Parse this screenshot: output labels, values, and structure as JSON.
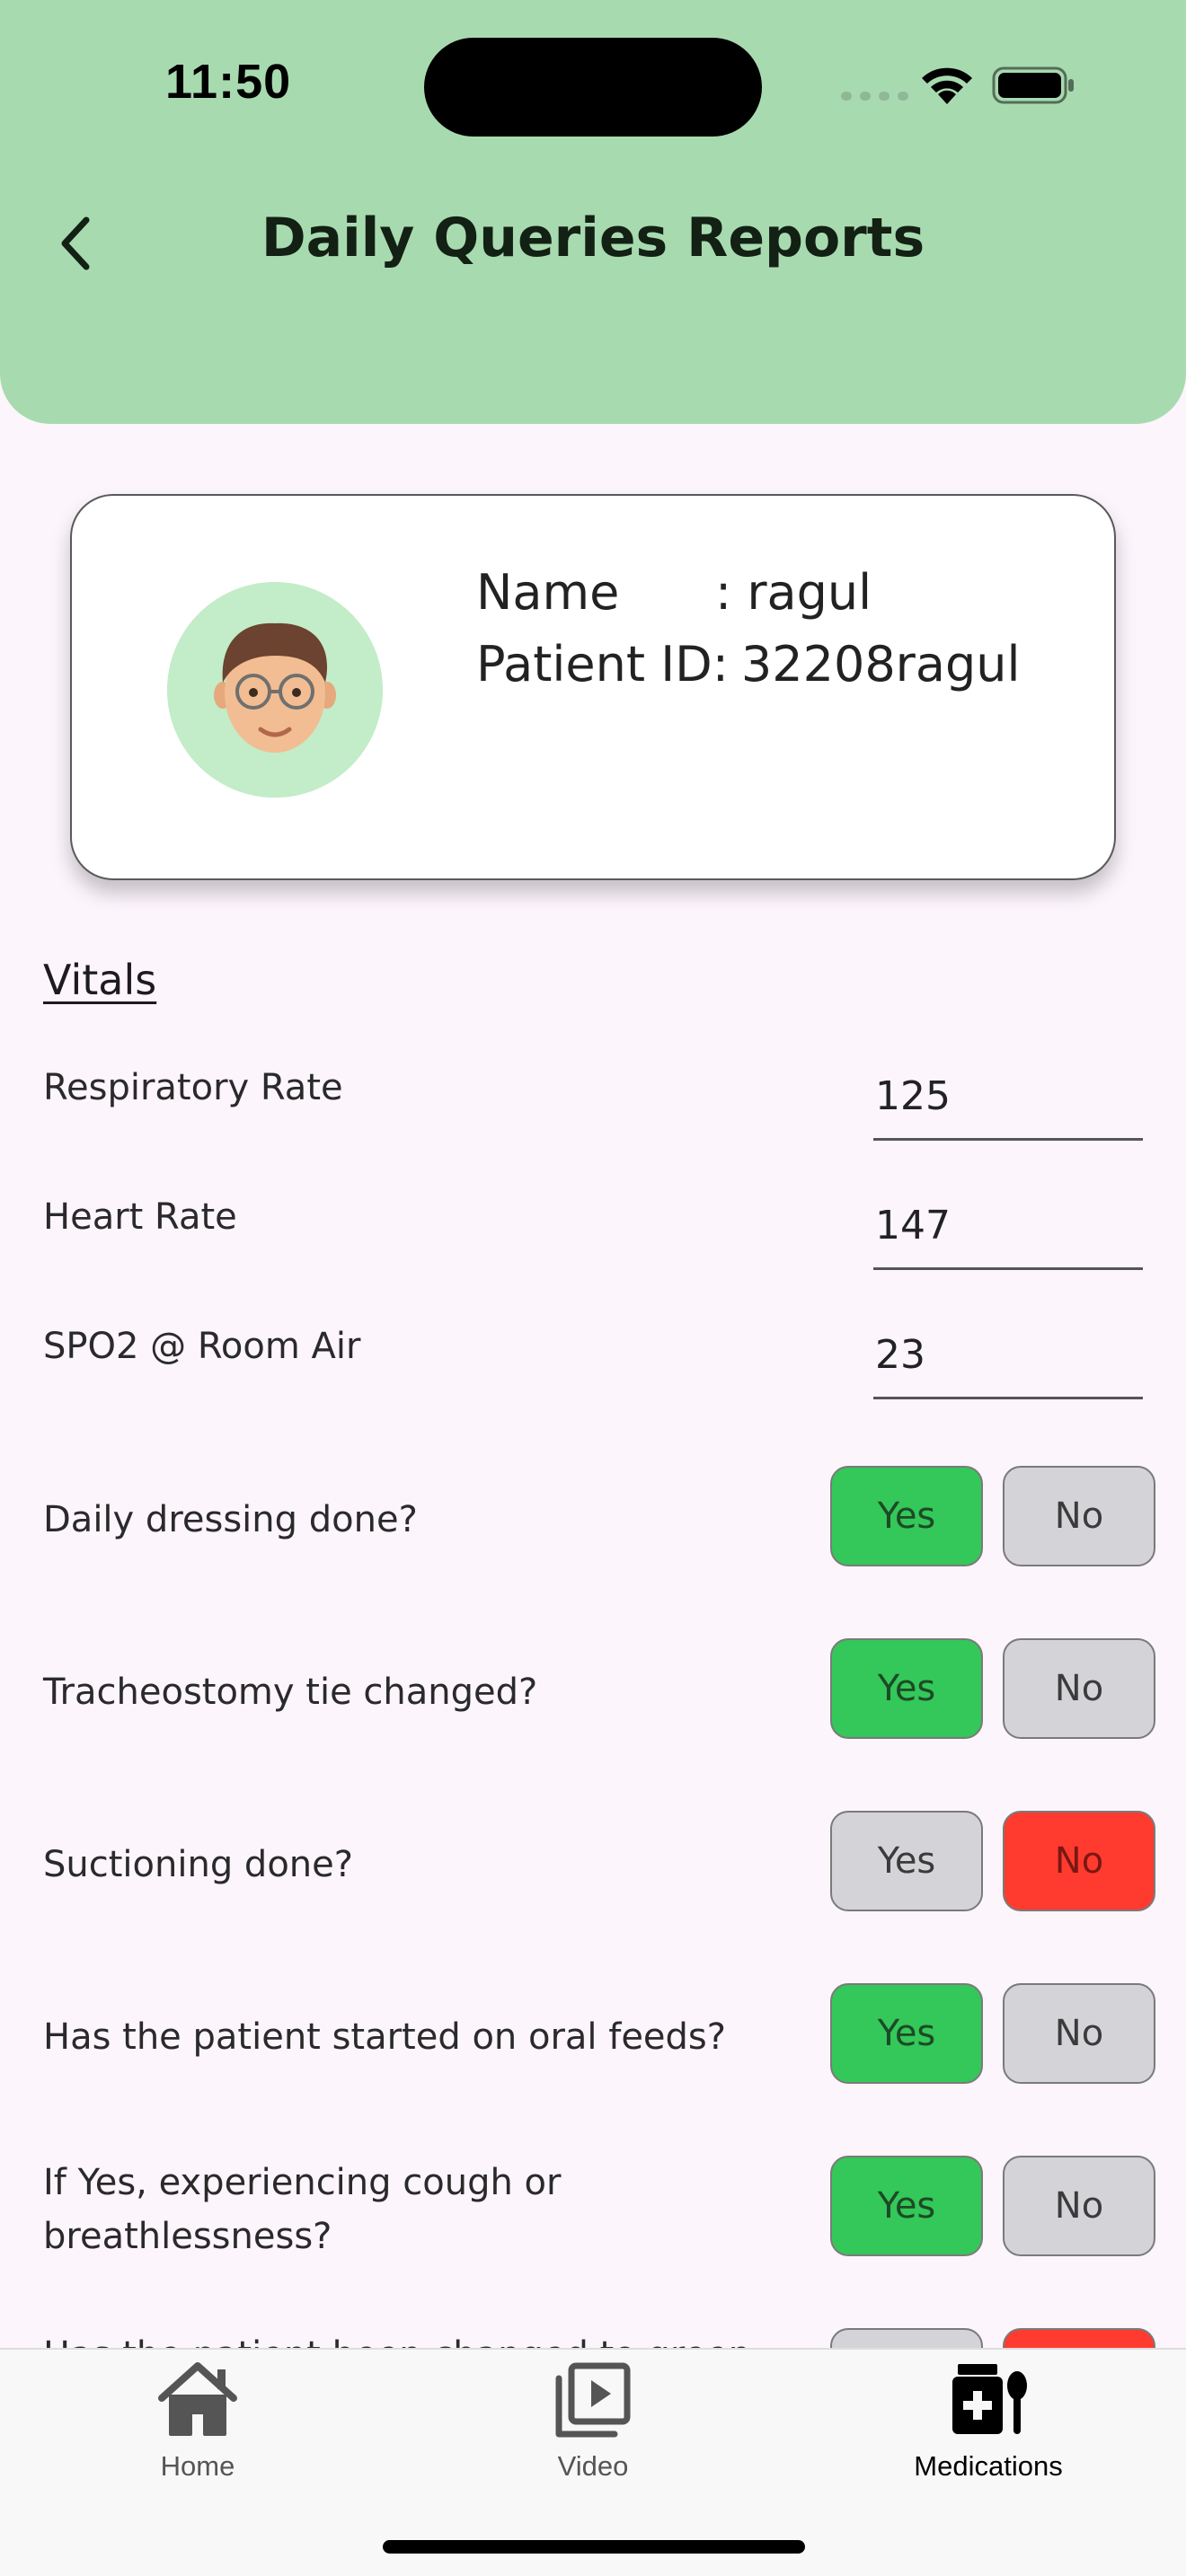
{
  "status_bar": {
    "time": "11:50"
  },
  "header": {
    "title": "Daily Queries Reports",
    "back_icon": "chevron-left-icon"
  },
  "patient": {
    "name_label": "Name",
    "name_value": ": ragul",
    "id_label": "Patient ID:",
    "id_value": "32208ragul",
    "avatar_icon": "memoji-avatar"
  },
  "vitals": {
    "title": "Vitals",
    "items": [
      {
        "label": "Respiratory Rate",
        "value": "125"
      },
      {
        "label": "Heart Rate",
        "value": "147"
      },
      {
        "label": "SPO2 @ Room Air",
        "value": "23"
      }
    ]
  },
  "questions": {
    "yes_label": "Yes",
    "no_label": "No",
    "items": [
      {
        "label": "Daily dressing done?",
        "selected": "yes"
      },
      {
        "label": "Tracheostomy tie changed?",
        "selected": "yes"
      },
      {
        "label": "Suctioning done?",
        "selected": "no"
      },
      {
        "label": "Has the patient started on oral feeds?",
        "selected": "yes"
      },
      {
        "label": "If Yes, experiencing cough or breathlessness?",
        "selected": "yes"
      },
      {
        "label": "Has the patient been changed to green",
        "selected": "no"
      }
    ]
  },
  "tab_bar": {
    "tabs": [
      {
        "label": "Home",
        "icon": "home-icon",
        "active": false
      },
      {
        "label": "Video",
        "icon": "video-library-icon",
        "active": false
      },
      {
        "label": "Medications",
        "icon": "medication-icon",
        "active": true
      }
    ]
  },
  "colors": {
    "header_bg": "#a8dab0",
    "yes_selected": "#34c759",
    "no_selected": "#ff3b30",
    "unselected": "#d4d4d8"
  }
}
